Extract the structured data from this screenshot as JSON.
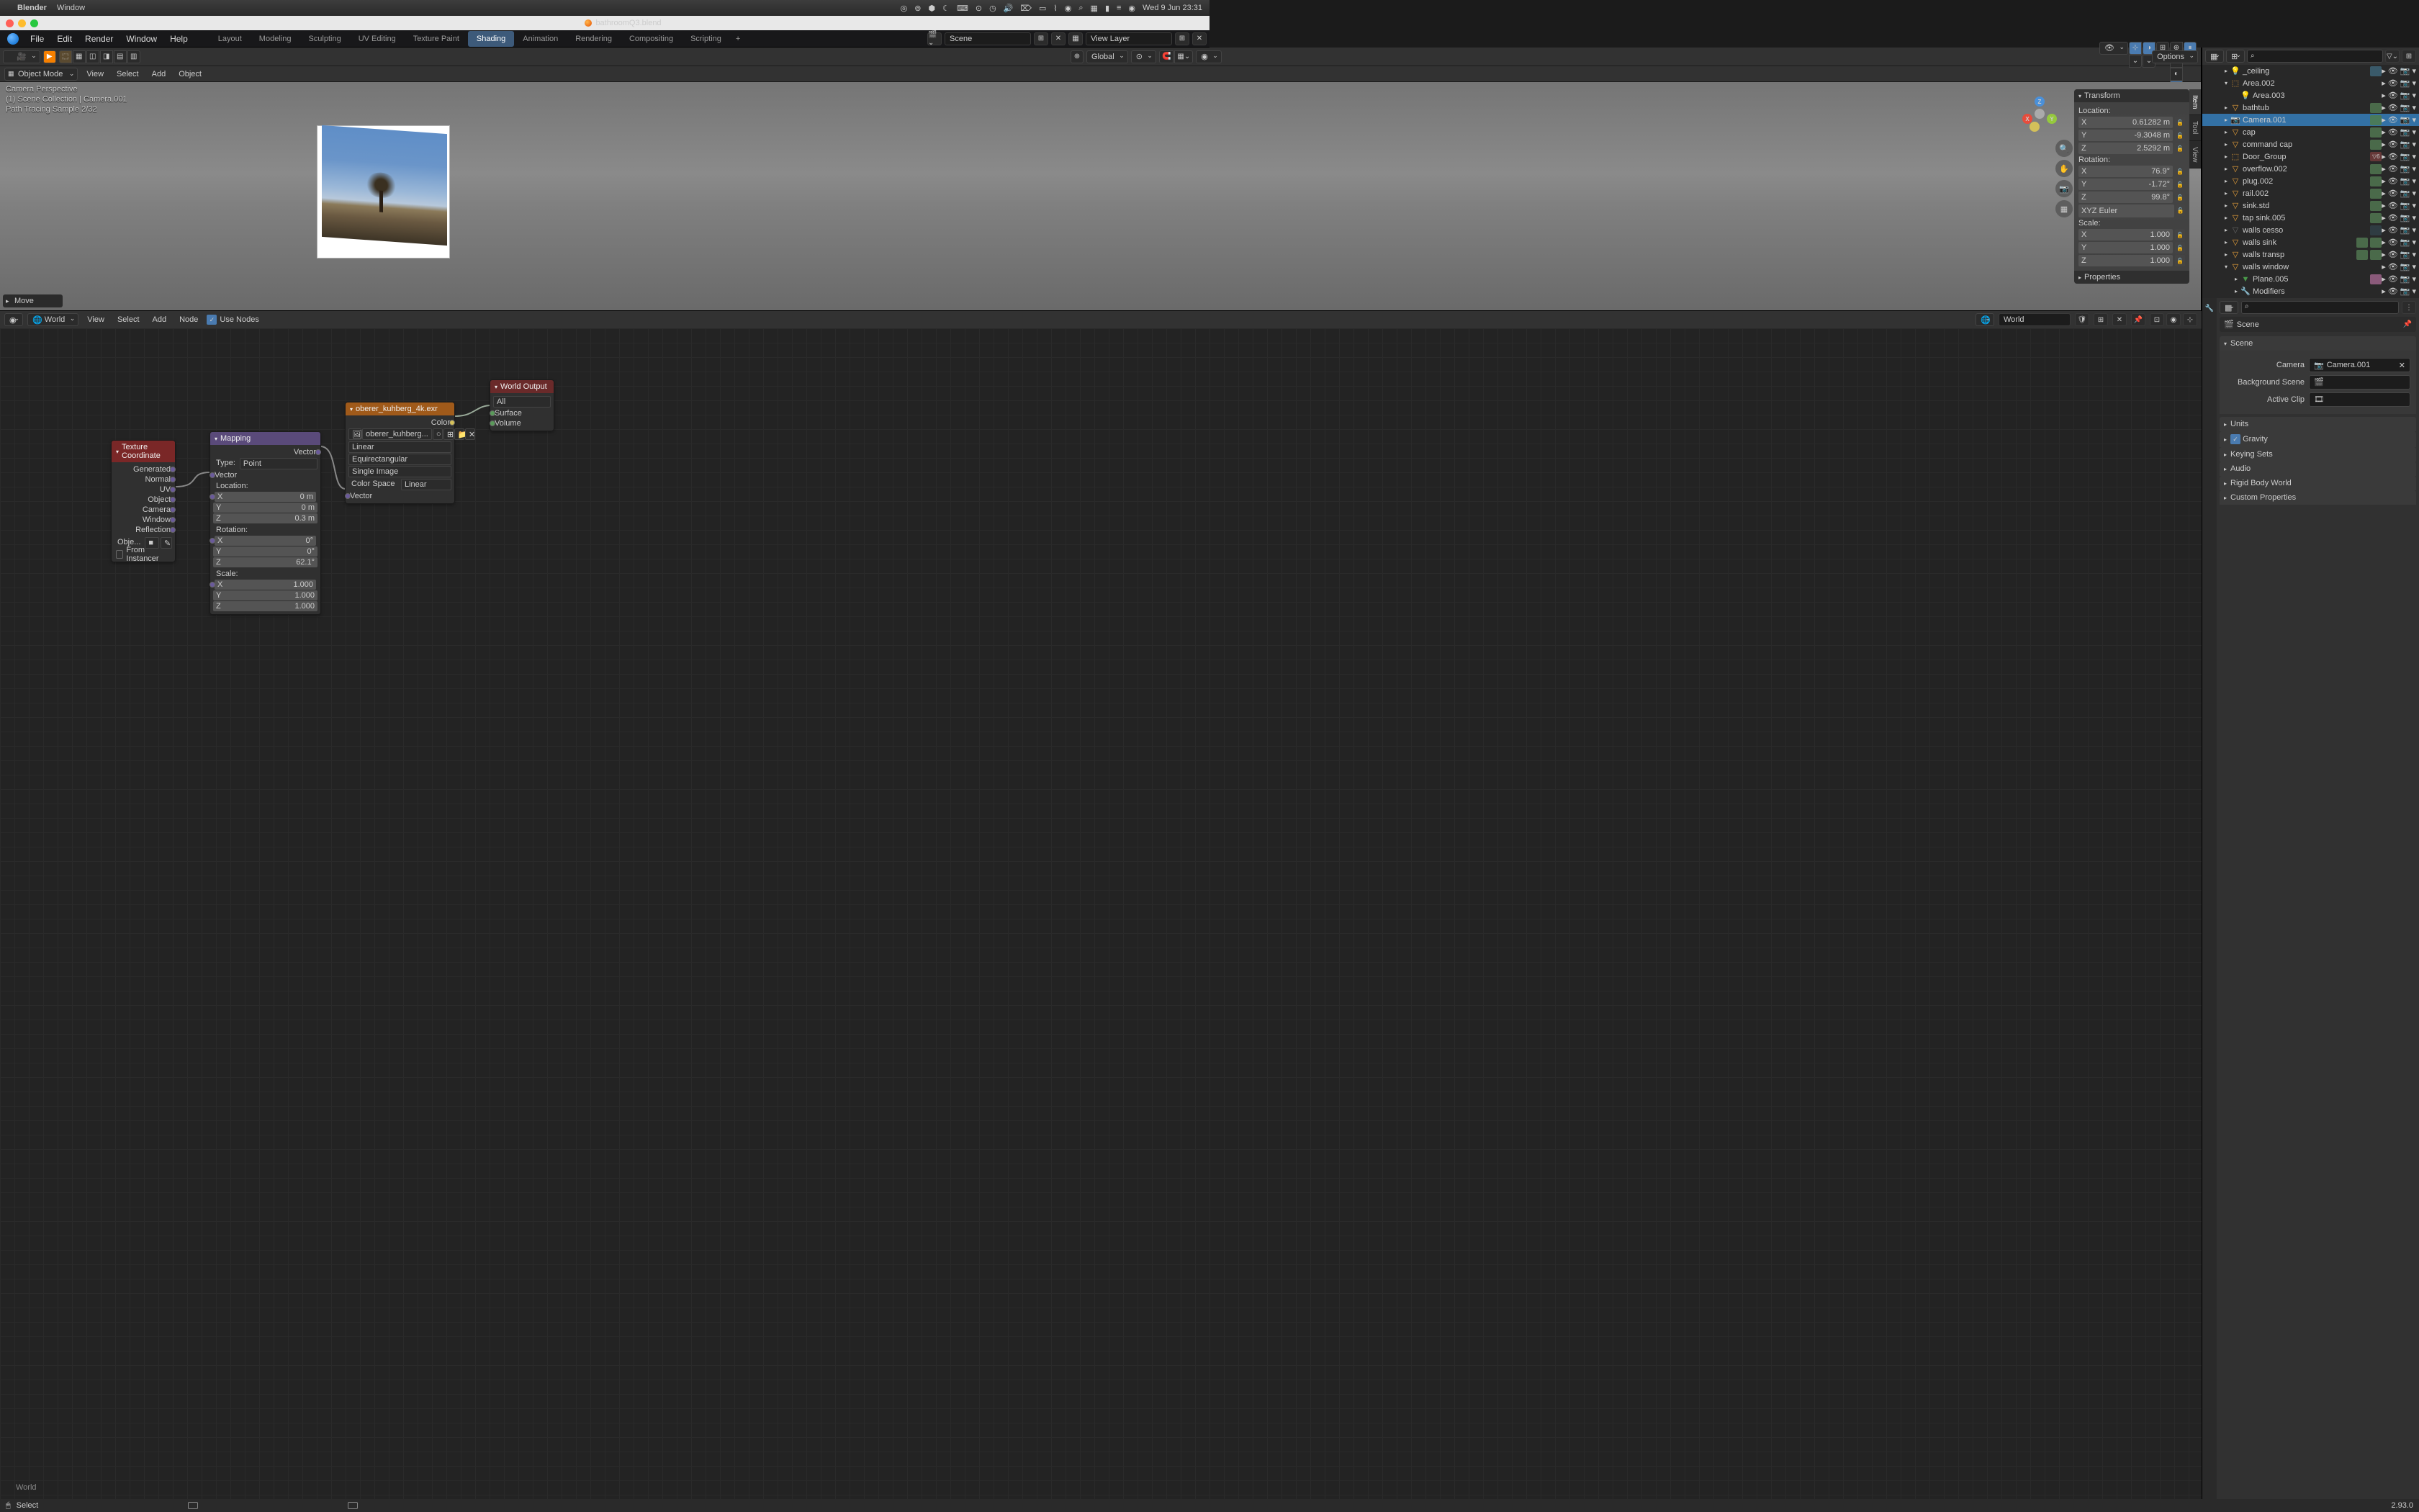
{
  "mac_menubar": {
    "app": "Blender",
    "items": [
      "Window"
    ],
    "clock": "Wed 9 Jun  23:31"
  },
  "window": {
    "title": "bathroomQ3.blend"
  },
  "top_menu": [
    "File",
    "Edit",
    "Render",
    "Window",
    "Help"
  ],
  "workspaces": [
    "Layout",
    "Modeling",
    "Sculpting",
    "UV Editing",
    "Texture Paint",
    "Shading",
    "Animation",
    "Rendering",
    "Compositing",
    "Scripting"
  ],
  "workspace_active": "Shading",
  "header_right": {
    "scene_label": "Scene",
    "viewlayer_label": "View Layer"
  },
  "viewport_header": {
    "orientation": "Global",
    "options": "Options"
  },
  "mode_bar": {
    "mode": "Object Mode",
    "menus": [
      "View",
      "Select",
      "Add",
      "Object"
    ]
  },
  "viewport_overlay": {
    "line1": "Camera Perspective",
    "line2": "(1) Scene Collection | Camera.001",
    "line3": "Path Tracing Sample 2/32",
    "last_op": "Move"
  },
  "transform": {
    "title": "Transform",
    "location_label": "Location:",
    "loc": {
      "x": "0.61282 m",
      "y": "-9.3048 m",
      "z": "2.5292 m"
    },
    "rotation_label": "Rotation:",
    "rot": {
      "x": "76.9°",
      "y": "-1.72°",
      "z": "99.8°"
    },
    "rot_mode": "XYZ Euler",
    "scale_label": "Scale:",
    "scale": {
      "x": "1.000",
      "y": "1.000",
      "z": "1.000"
    },
    "properties_title": "Properties"
  },
  "npanel_tabs": [
    "Item",
    "Tool",
    "View"
  ],
  "outliner": {
    "items": [
      {
        "depth": 2,
        "disc": "▸",
        "icon": "light",
        "name": "_ceiling",
        "extras": [
          "mat"
        ]
      },
      {
        "depth": 2,
        "disc": "▾",
        "icon": "empty",
        "name": "Area.002"
      },
      {
        "depth": 3,
        "disc": "",
        "icon": "light",
        "name": "Area.003"
      },
      {
        "depth": 2,
        "disc": "▸",
        "icon": "mesh",
        "name": "bathtub",
        "extras": [
          "mat-g"
        ]
      },
      {
        "depth": 2,
        "disc": "▸",
        "icon": "cam",
        "name": "Camera.001",
        "active": true,
        "extras": [
          "cam-data"
        ]
      },
      {
        "depth": 2,
        "disc": "▸",
        "icon": "mesh",
        "name": "cap",
        "extras": [
          "mat-g"
        ]
      },
      {
        "depth": 2,
        "disc": "▸",
        "icon": "mesh",
        "name": "command cap",
        "extras": [
          "mat-g"
        ]
      },
      {
        "depth": 2,
        "disc": "▸",
        "icon": "empty",
        "name": "Door_Group",
        "extras": [
          "mod-6"
        ]
      },
      {
        "depth": 2,
        "disc": "▸",
        "icon": "mesh",
        "name": "overflow.002",
        "extras": [
          "mat-g"
        ]
      },
      {
        "depth": 2,
        "disc": "▸",
        "icon": "mesh",
        "name": "plug.002",
        "extras": [
          "mat-g"
        ]
      },
      {
        "depth": 2,
        "disc": "▸",
        "icon": "mesh",
        "name": "rail.002",
        "extras": [
          "mat-g"
        ]
      },
      {
        "depth": 2,
        "disc": "▸",
        "icon": "mesh",
        "name": "sink.std",
        "extras": [
          "mat-g"
        ]
      },
      {
        "depth": 2,
        "disc": "▸",
        "icon": "mesh",
        "name": "tap sink.005",
        "extras": [
          "mat-g"
        ]
      },
      {
        "depth": 2,
        "disc": "▸",
        "icon": "mesh-dim",
        "name": "walls cesso",
        "extras": [
          "mat-dim"
        ]
      },
      {
        "depth": 2,
        "disc": "▸",
        "icon": "mesh",
        "name": "walls sink",
        "extras": [
          "mat-g",
          "mat-g"
        ]
      },
      {
        "depth": 2,
        "disc": "▸",
        "icon": "mesh",
        "name": "walls transp",
        "extras": [
          "mat-g",
          "mat-g"
        ]
      },
      {
        "depth": 2,
        "disc": "▾",
        "icon": "mesh",
        "name": "walls window"
      },
      {
        "depth": 3,
        "disc": "▸",
        "icon": "mesh-data",
        "name": "Plane.005",
        "extras": [
          "mat-pink"
        ]
      },
      {
        "depth": 3,
        "disc": "▸",
        "icon": "wrench",
        "name": "Modifiers"
      }
    ]
  },
  "props": {
    "breadcrumb": "Scene",
    "scene_panel": "Scene",
    "camera_label": "Camera",
    "camera_value": "Camera.001",
    "bg_scene_label": "Background Scene",
    "active_clip_label": "Active Clip",
    "panels": [
      "Units",
      "Gravity",
      "Keying Sets",
      "Audio",
      "Rigid Body World",
      "Custom Properties"
    ]
  },
  "node_editor": {
    "type": "World",
    "menus": [
      "View",
      "Select",
      "Add",
      "Node"
    ],
    "use_nodes_label": "Use Nodes",
    "datablock": "World",
    "status": "World"
  },
  "nodes": {
    "texcoord": {
      "title": "Texture Coordinate",
      "outputs": [
        "Generated",
        "Normal",
        "UV",
        "Object",
        "Camera",
        "Window",
        "Reflection"
      ],
      "obj_label": "Obje...",
      "from_instancer": "From Instancer"
    },
    "mapping": {
      "title": "Mapping",
      "vector_out": "Vector",
      "type_label": "Type:",
      "type_value": "Point",
      "vector_in": "Vector",
      "location_label": "Location:",
      "loc": {
        "x": "0 m",
        "y": "0 m",
        "z": "0.3 m"
      },
      "rotation_label": "Rotation:",
      "rot": {
        "x": "0°",
        "y": "0°",
        "z": "62.1°"
      },
      "scale_label": "Scale:",
      "scale": {
        "x": "1.000",
        "y": "1.000",
        "z": "1.000"
      }
    },
    "env": {
      "title": "oberer_kuhberg_4k.exr",
      "color_out": "Color",
      "image": "oberer_kuhberg...",
      "interp": "Linear",
      "projection": "Equirectangular",
      "source": "Single Image",
      "colorspace_label": "Color Space",
      "colorspace_value": "Linear",
      "vector_in": "Vector"
    },
    "output": {
      "title": "World Output",
      "target": "All",
      "surface": "Surface",
      "volume": "Volume"
    }
  },
  "statusbar": {
    "select": "Select",
    "version": "2.93.0"
  }
}
